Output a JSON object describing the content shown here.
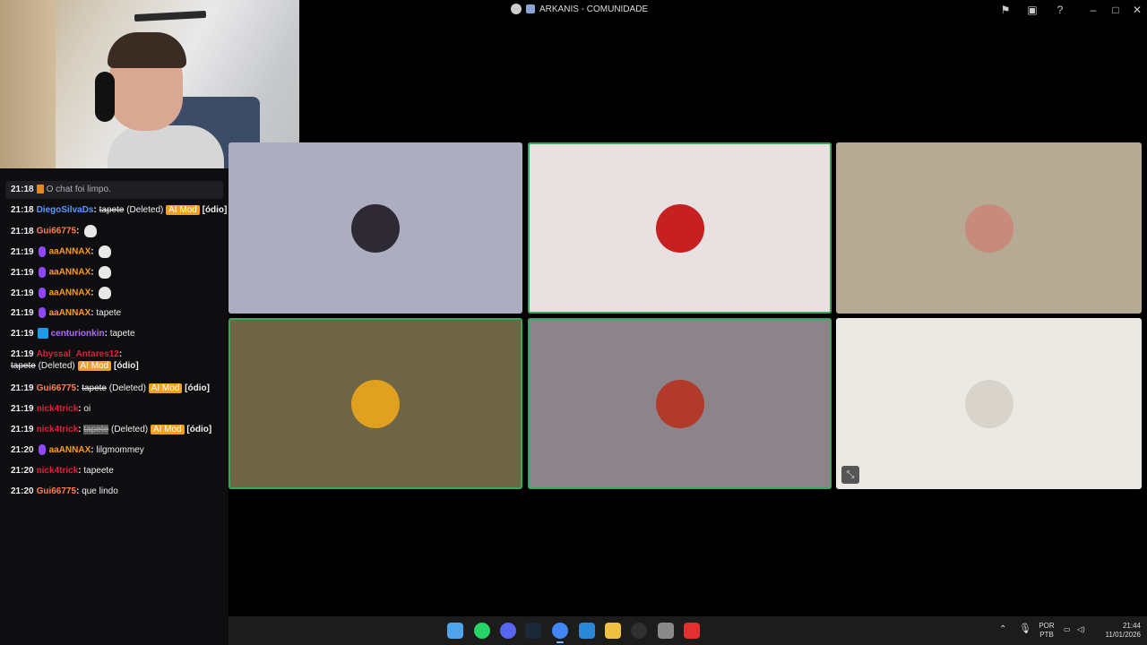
{
  "window": {
    "title": "ARKANIS - COMUNIDADE",
    "controls": [
      "flag-icon",
      "inbox-icon",
      "help-icon",
      "minimize-icon",
      "maximize-icon",
      "close-icon"
    ]
  },
  "chat": {
    "cleared": {
      "time": "21:18",
      "text": "O chat foi limpo."
    },
    "lines": [
      {
        "time": "21:18",
        "user": "DiegoSilvaDs",
        "user_color": "#5b99ff",
        "msg": "tapete",
        "deleted": true,
        "status": "(Deleted)",
        "tag": "AI Mod",
        "reason": "[ódio]"
      },
      {
        "time": "21:18",
        "user": "Gui66775",
        "user_color": "#ff7f50",
        "emote": "speech-bubble-emote"
      },
      {
        "time": "21:19",
        "user": "aaANNAX",
        "user_color": "#ff9a1f",
        "badge": "mic",
        "emote": "duck-emote"
      },
      {
        "time": "21:19",
        "user": "aaANNAX",
        "user_color": "#ff9a1f",
        "badge": "mic",
        "emote": "duck-emote"
      },
      {
        "time": "21:19",
        "user": "aaANNAX",
        "user_color": "#ff9a1f",
        "badge": "mic",
        "emote": "duck-emote"
      },
      {
        "time": "21:19",
        "user": "aaANNAX",
        "user_color": "#ff9a1f",
        "badge": "mic",
        "msg": "tapete"
      },
      {
        "time": "21:19",
        "user": "centurionkin",
        "user_color": "#b46bff",
        "badge": "prime",
        "msg": "tapete"
      },
      {
        "time": "21:19",
        "user": "Abyssal_Antares12",
        "user_color": "#e0203c",
        "msg": "tapete",
        "deleted": true,
        "status": "(Deleted)",
        "tag": "AI Mod",
        "reason": "[ódio]"
      },
      {
        "time": "21:19",
        "user": "Gui66775",
        "user_color": "#ff7f50",
        "msg": "tapete",
        "deleted": true,
        "status": "(Deleted)",
        "tag": "AI Mod",
        "reason": "[ódio]"
      },
      {
        "time": "21:19",
        "user": "nick4trick",
        "user_color": "#e0203c",
        "msg": "oi"
      },
      {
        "time": "21:19",
        "user": "nick4trick",
        "user_color": "#e0203c",
        "msg": "tapete",
        "deleted": true,
        "status": "(Deleted)",
        "tag": "AI Mod",
        "reason": "[ódio]"
      },
      {
        "time": "21:20",
        "user": "aaANNAX",
        "user_color": "#ff9a1f",
        "badge": "mic",
        "msg": "lilgmommey"
      },
      {
        "time": "21:20",
        "user": "nick4trick",
        "user_color": "#e0203c",
        "msg": "tapeete"
      },
      {
        "time": "21:20",
        "user": "Gui66775",
        "user_color": "#ff7f50",
        "msg": "que lindo"
      }
    ]
  },
  "tiles": [
    {
      "name": "participant-tile-1",
      "bg": "#adadc2",
      "avatar": "#2e2a33",
      "active": false
    },
    {
      "name": "participant-tile-2",
      "bg": "#e9e0e1",
      "avatar": "#c62020",
      "active": true
    },
    {
      "name": "participant-tile-3",
      "bg": "#b6aa94",
      "avatar": "#c88a7a",
      "active": false
    },
    {
      "name": "participant-tile-4",
      "bg": "#6e6546",
      "avatar": "#e0a020",
      "active": true
    },
    {
      "name": "participant-tile-5",
      "bg": "#8c848a",
      "avatar": "#b23a2a",
      "active": true
    },
    {
      "name": "participant-tile-6",
      "bg": "#ece9e4",
      "avatar": "#d8d4cc",
      "active": false
    }
  ],
  "taskbar": {
    "apps": [
      "windows-start-icon",
      "whatsapp-icon",
      "discord-icon",
      "steam-icon",
      "chrome-icon",
      "photos-icon",
      "file-explorer-icon",
      "obs-icon",
      "settings-icon",
      "youtube-icon"
    ],
    "lang_top": "POR",
    "lang_bottom": "PTB",
    "time": "21:44",
    "date": "11/01/2026"
  }
}
